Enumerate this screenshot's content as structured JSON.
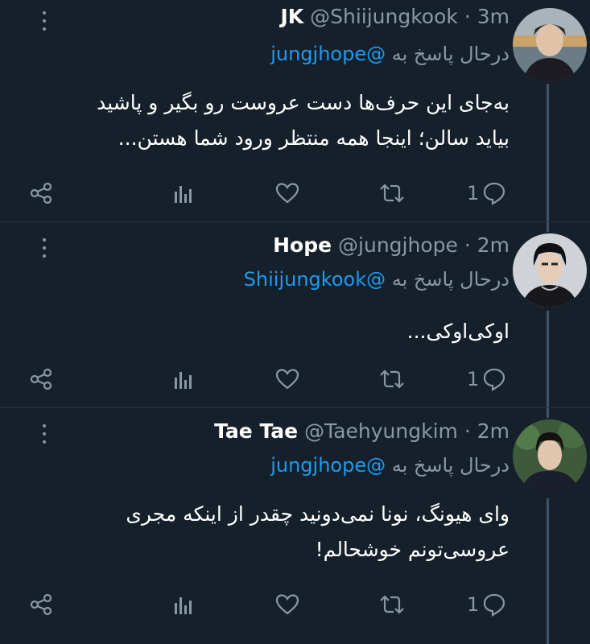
{
  "colors": {
    "background": "#15202b",
    "text_primary": "#ffffff",
    "text_secondary": "#8899a6",
    "mention": "#1d9bf0",
    "thread_line": "#3d5466"
  },
  "tweets": [
    {
      "name": "JK",
      "handle": "@Shiijungkook",
      "dot": "·",
      "time": "3m",
      "reply_prefix": "درحال پاسخ به",
      "reply_to": "jungjhope@",
      "body_lines": [
        "به‌جای این حرف‌ها دست عروست رو بگیر و پاشید",
        "بیاید سالن؛ اینجا همه منتظر ورود شما هستن..."
      ],
      "reply_count": "1",
      "icons": [
        "share-icon",
        "analytics-icon",
        "like-icon",
        "retweet-icon",
        "reply-icon"
      ]
    },
    {
      "name": "Hope",
      "handle": "@jungjhope",
      "dot": "·",
      "time": "2m",
      "reply_prefix": "درحال پاسخ به",
      "reply_to": "Shiijungkook@",
      "body_lines": [
        "اوکی‌اوکی..."
      ],
      "reply_count": "1",
      "icons": [
        "share-icon",
        "analytics-icon",
        "like-icon",
        "retweet-icon",
        "reply-icon"
      ]
    },
    {
      "name": "Tae Tae",
      "handle": "@Taehyungkim",
      "dot": "·",
      "time": "2m",
      "reply_prefix": "درحال پاسخ به",
      "reply_to": "jungjhope@",
      "body_lines": [
        "وای هیونگ، نونا نمی‌دونید چقدر از اینکه مجری",
        "عروسی‌تونم خوشحالم!"
      ],
      "reply_count": "1",
      "icons": [
        "share-icon",
        "analytics-icon",
        "like-icon",
        "retweet-icon",
        "reply-icon"
      ]
    }
  ]
}
